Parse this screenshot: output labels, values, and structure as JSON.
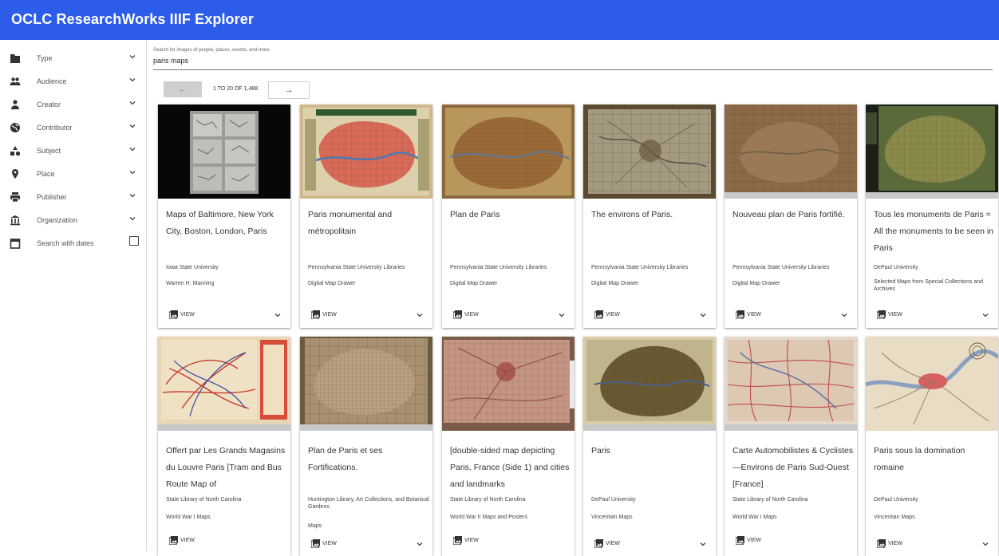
{
  "app": {
    "title": "OCLC ResearchWorks IIIF Explorer"
  },
  "colors": {
    "accent": "#2c5ce8"
  },
  "sidebar": {
    "items": [
      {
        "label": "Type",
        "icon": "folder-icon"
      },
      {
        "label": "Audience",
        "icon": "people-icon"
      },
      {
        "label": "Creator",
        "icon": "person-icon"
      },
      {
        "label": "Contributor",
        "icon": "globe-icon"
      },
      {
        "label": "Subject",
        "icon": "shapes-icon"
      },
      {
        "label": "Place",
        "icon": "pin-icon"
      },
      {
        "label": "Publisher",
        "icon": "printer-icon"
      },
      {
        "label": "Organization",
        "icon": "institution-icon"
      },
      {
        "label": "Search with dates",
        "icon": "calendar-icon"
      }
    ]
  },
  "search": {
    "placeholder": "Search for images of people, places, events, and more.",
    "value": "paris maps"
  },
  "pager": {
    "prev": "←",
    "info": "1 TO 20 OF 1,488",
    "next": "→"
  },
  "view_label": "VIEW",
  "cards": [
    {
      "title": "Maps of Baltimore, New York City, Boston, London, Paris",
      "org": "Iowa State University",
      "collection": "Warren H. Manning"
    },
    {
      "title": "Paris monumental and métropolitain",
      "org": "Pennsylvania State University Libraries",
      "collection": "Digital Map Drawer"
    },
    {
      "title": "Plan de Paris",
      "org": "Pennsylvania State University Libraries",
      "collection": "Digital Map Drawer"
    },
    {
      "title": "The environs of Paris.",
      "org": "Pennsylvania State University Libraries",
      "collection": "Digital Map Drawer"
    },
    {
      "title": "Nouveau plan de Paris fortifié.",
      "org": "Pennsylvania State University Libraries",
      "collection": "Digital Map Drawer"
    },
    {
      "title": "Tous les monuments de Paris = All the monuments to be seen in Paris",
      "org": "DePaul University",
      "collection": "Selected Maps from Special Collections and Archives"
    },
    {
      "title": "Offert par Les Grands Magasins du Louvre Paris [Tram and Bus Route Map of",
      "org": "State Library of North Carolina",
      "collection": "World War I Maps"
    },
    {
      "title": "Plan de Paris et ses Fortifications.",
      "org": "Huntington Library, Art Collections, and Botanical Gardens",
      "collection": "Maps"
    },
    {
      "title": "[double-sided map depicting Paris, France (Side 1) and cities and landmarks",
      "org": "State Library of North Carolina",
      "collection": "World War II Maps and Posters"
    },
    {
      "title": "Paris",
      "org": "DePaul University",
      "collection": "Vincentian Maps"
    },
    {
      "title": "Carte Automobilistes & Cyclistes—Environs de Paris Sud-Ouest [France]",
      "org": "State Library of North Carolina",
      "collection": "World War I Maps"
    },
    {
      "title": "Paris sous la domination romaine",
      "org": "DePaul University",
      "collection": "Vincentian Maps"
    }
  ]
}
